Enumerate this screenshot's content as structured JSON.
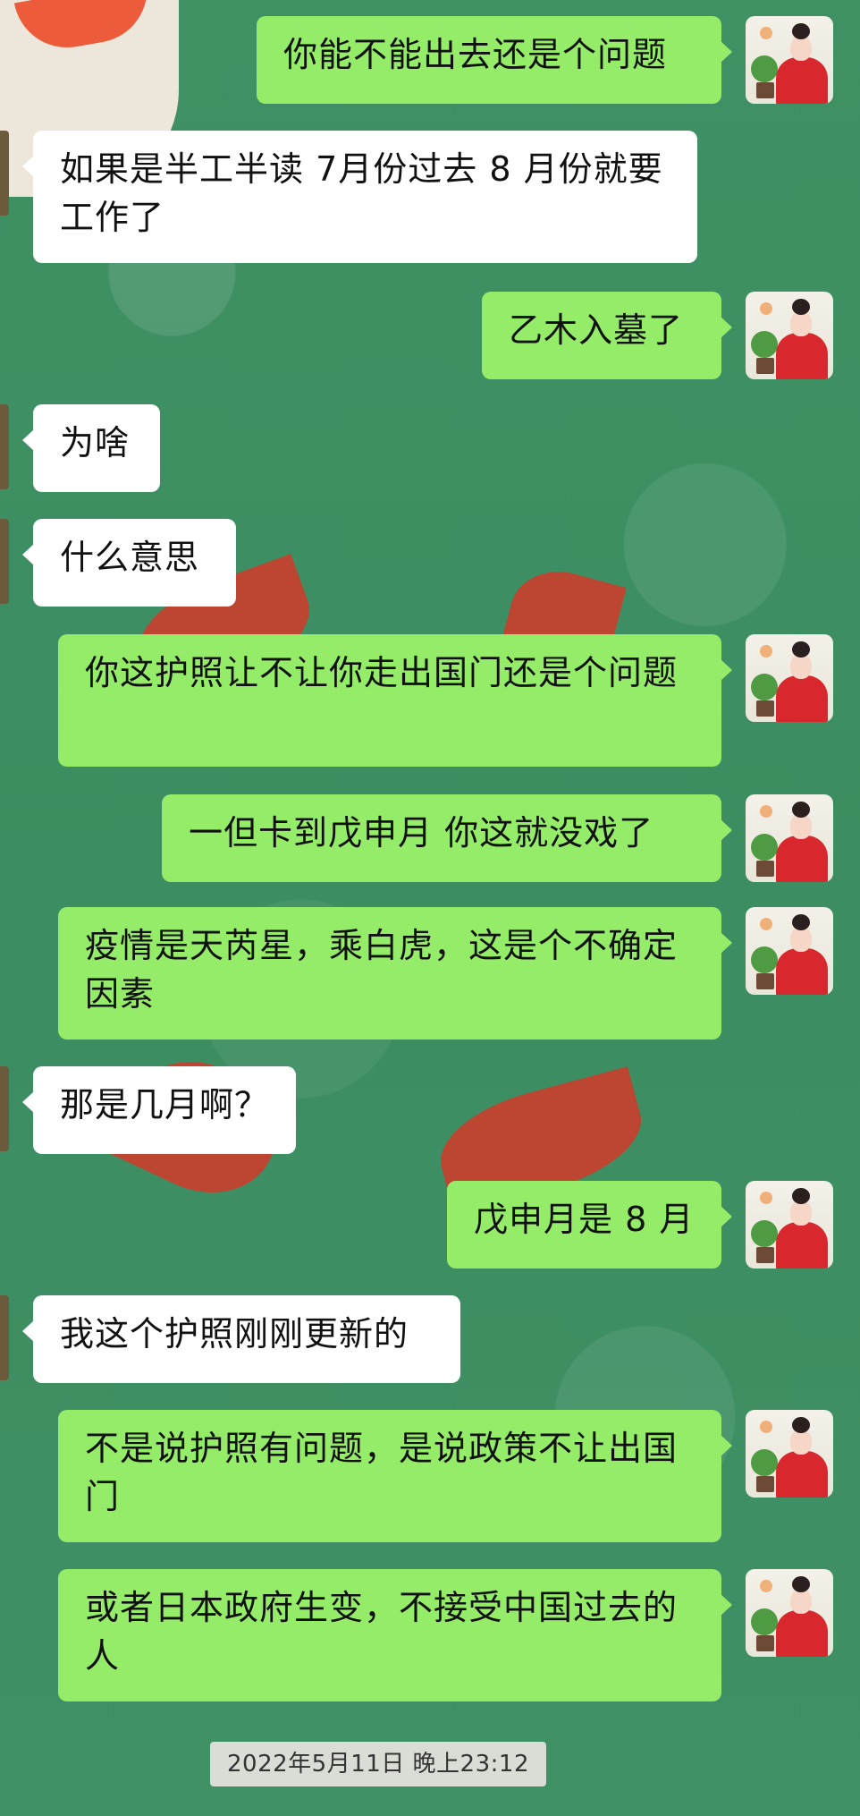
{
  "messages": [
    {
      "side": "right",
      "text": "你能不能出去还是个问题"
    },
    {
      "side": "left",
      "text": "如果是半工半读  7月份过去 8 月份就要工作了"
    },
    {
      "side": "right",
      "text": "乙木入墓了"
    },
    {
      "side": "left",
      "text": "为啥"
    },
    {
      "side": "left",
      "text": "什么意思"
    },
    {
      "side": "right",
      "text": "你这护照让不让你走出国门还是个问题"
    },
    {
      "side": "right",
      "text": "一但卡到戊申月  你这就没戏了"
    },
    {
      "side": "right",
      "text": "疫情是天芮星，乘白虎，这是个不确定因素"
    },
    {
      "side": "left",
      "text": "那是几月啊？"
    },
    {
      "side": "right",
      "text": "戊申月是 8 月"
    },
    {
      "side": "left",
      "text": "我这个护照刚刚更新的"
    },
    {
      "side": "right",
      "text": "不是说护照有问题，是说政策不让出国门"
    },
    {
      "side": "right",
      "text": "或者日本政府生变，不接受中国过去的人"
    }
  ],
  "timestamp": "2022年5月11日  晚上23:12",
  "colors": {
    "sent_bubble": "#95ec69",
    "received_bubble": "#ffffff",
    "background": "#3f8f63"
  },
  "icons": {
    "sender_avatar": "woman-red-hanfu-avatar",
    "received_avatar_partial": "contact-avatar-edge"
  }
}
